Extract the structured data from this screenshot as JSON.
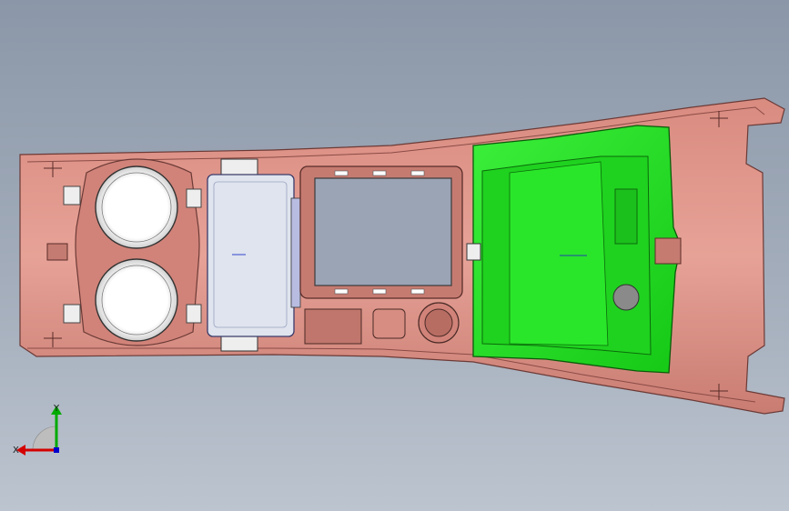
{
  "viewport": {
    "background_top": "#8b97a8",
    "background_bottom": "#bcc4cf"
  },
  "part": {
    "body_color": "#e39a8e",
    "edge_color": "#6b3a36",
    "insert_color": "#22dd22",
    "insert_edge": "#0a5a0a",
    "cupholder_color": "#f5f5f5",
    "button_panel_color": "#dfe4ee"
  },
  "triad": {
    "x_label": "X",
    "y_label": "Y",
    "x_color": "#d40000",
    "y_color": "#00aa00",
    "z_color": "#0000cc"
  }
}
